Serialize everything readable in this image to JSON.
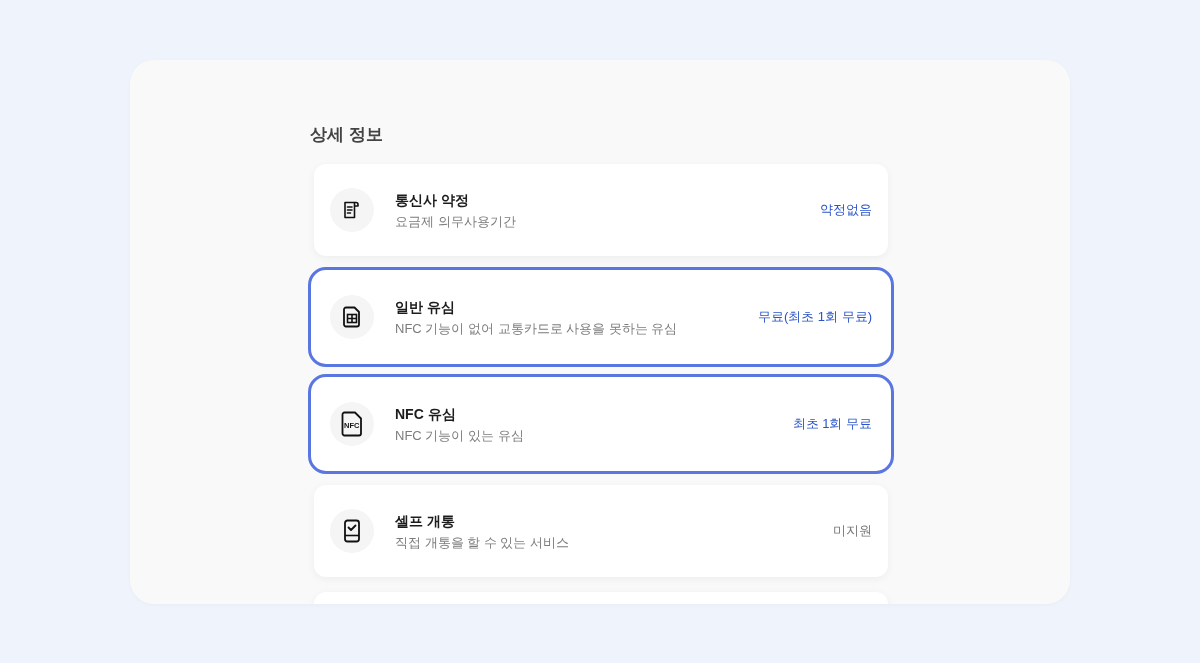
{
  "section_title": "상세 정보",
  "items": [
    {
      "kind": "document",
      "title": "통신사 약정",
      "description": "요금제 의무사용기간",
      "value": "약정없음",
      "available": true,
      "selected": false
    },
    {
      "kind": "sim",
      "title": "일반 유심",
      "description": "NFC 기능이 없어 교통카드로 사용을 못하는 유심",
      "value": "무료(최초 1회 무료)",
      "available": true,
      "selected": true
    },
    {
      "kind": "nfc",
      "icon_label": "NFC",
      "title": "NFC 유심",
      "description": "NFC 기능이 있는 유심",
      "value": "최초 1회 무료",
      "available": true,
      "selected": true
    },
    {
      "kind": "self",
      "title": "셀프 개통",
      "description": "직접 개통을 할 수 있는 서비스",
      "value": "미지원",
      "available": false,
      "selected": false
    }
  ]
}
